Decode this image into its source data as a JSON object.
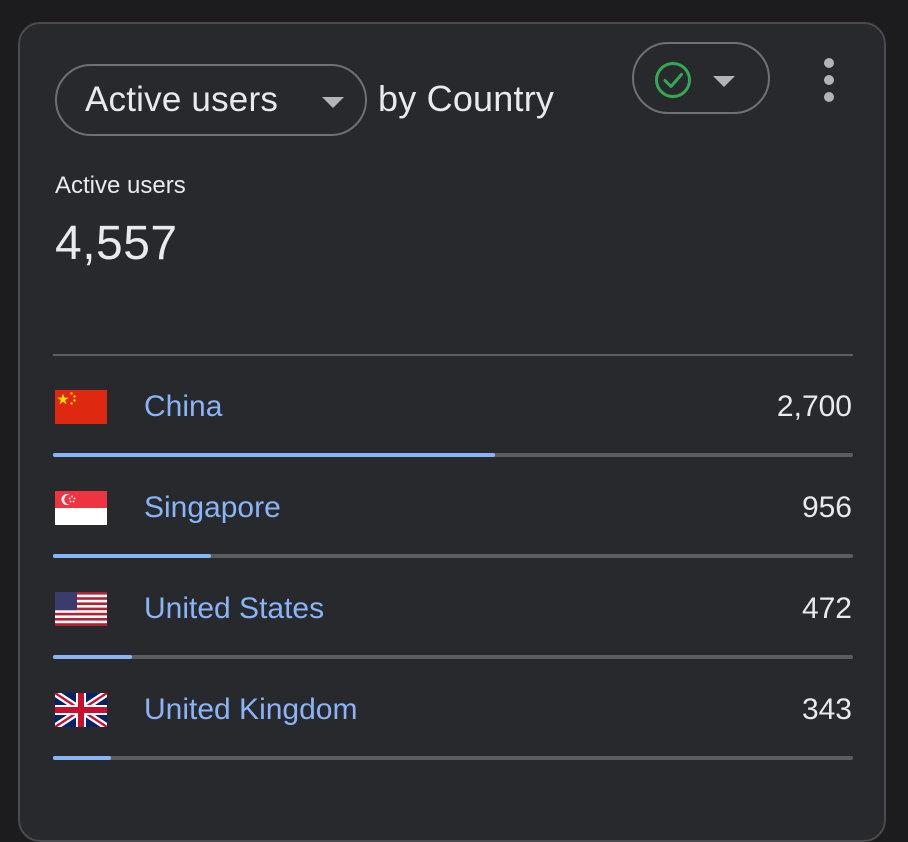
{
  "card": {
    "metric_chip_label": "Active users",
    "title_suffix": "by Country",
    "metric_title": "Active users",
    "metric_total": "4,557"
  },
  "colors": {
    "accent": "#8ab4f8",
    "check": "#34a853",
    "card_bg": "#28292c"
  },
  "icons": {
    "metric_dropdown": "caret-down-icon",
    "status": "check-circle-icon",
    "status_dropdown": "caret-down-icon",
    "more": "more-vert-icon"
  },
  "rows": [
    {
      "country": "China",
      "value": "2,700",
      "flag": "china-flag-icon",
      "share": 0.552
    },
    {
      "country": "Singapore",
      "value": "956",
      "flag": "singapore-flag-icon",
      "share": 0.197
    },
    {
      "country": "United States",
      "value": "472",
      "flag": "us-flag-icon",
      "share": 0.099
    },
    {
      "country": "United Kingdom",
      "value": "343",
      "flag": "uk-flag-icon",
      "share": 0.072
    }
  ]
}
